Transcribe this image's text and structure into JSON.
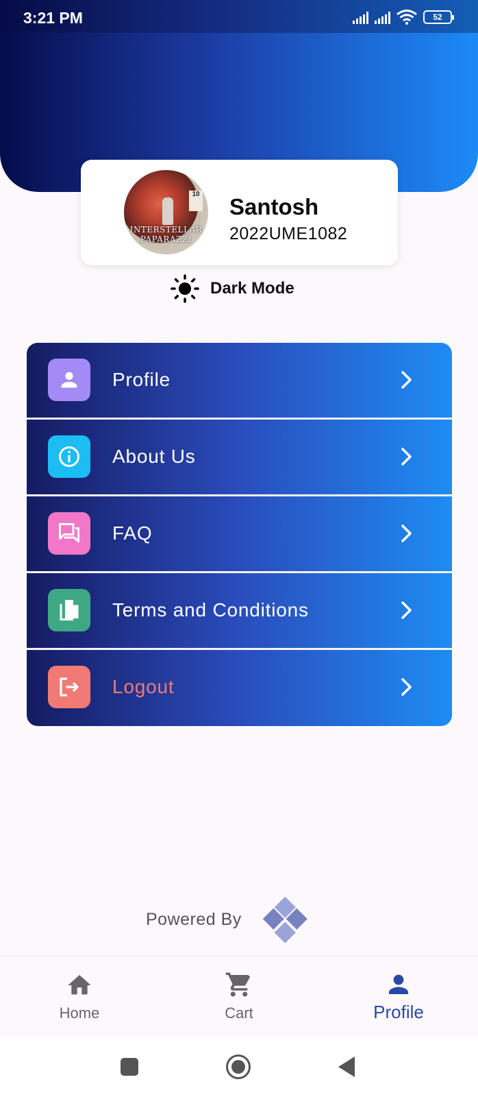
{
  "status_bar": {
    "time": "3:21 PM",
    "battery": "52"
  },
  "profile_card": {
    "name": "Santosh",
    "id": "2022UME1082",
    "avatar_text_line1": "INTERSTELLAR",
    "avatar_text_line2": "PAPARAZZI",
    "avatar_badge": "10"
  },
  "dark_mode": {
    "label": "Dark Mode",
    "icon": "sun-icon"
  },
  "menu": {
    "items": [
      {
        "label": "Profile",
        "icon": "person-icon",
        "icon_color": "#a48af4"
      },
      {
        "label": "About Us",
        "icon": "info-icon",
        "icon_color": "#1cbdf2"
      },
      {
        "label": "FAQ",
        "icon": "forum-icon",
        "icon_color": "#f277c8"
      },
      {
        "label": "Terms and Conditions",
        "icon": "documents-icon",
        "icon_color": "#3ea884"
      },
      {
        "label": "Logout",
        "icon": "logout-icon",
        "icon_color": "#f17a74",
        "label_color": "#f17a74"
      }
    ]
  },
  "footer": {
    "powered_label": "Powered By",
    "logo": "brand-logo-icon"
  },
  "bottom_nav": {
    "items": [
      {
        "label": "Home",
        "icon": "home-icon",
        "active": false
      },
      {
        "label": "Cart",
        "icon": "cart-icon",
        "active": false
      },
      {
        "label": "Profile",
        "icon": "person-icon",
        "active": true
      }
    ],
    "active_color": "#2a48a6",
    "inactive_color": "#666666"
  },
  "system_nav": {
    "buttons": [
      "recents-icon",
      "home-circle-icon",
      "back-icon"
    ]
  },
  "colors": {
    "header_gradient_start": "#060c4c",
    "header_gradient_end": "#1c8af8"
  }
}
